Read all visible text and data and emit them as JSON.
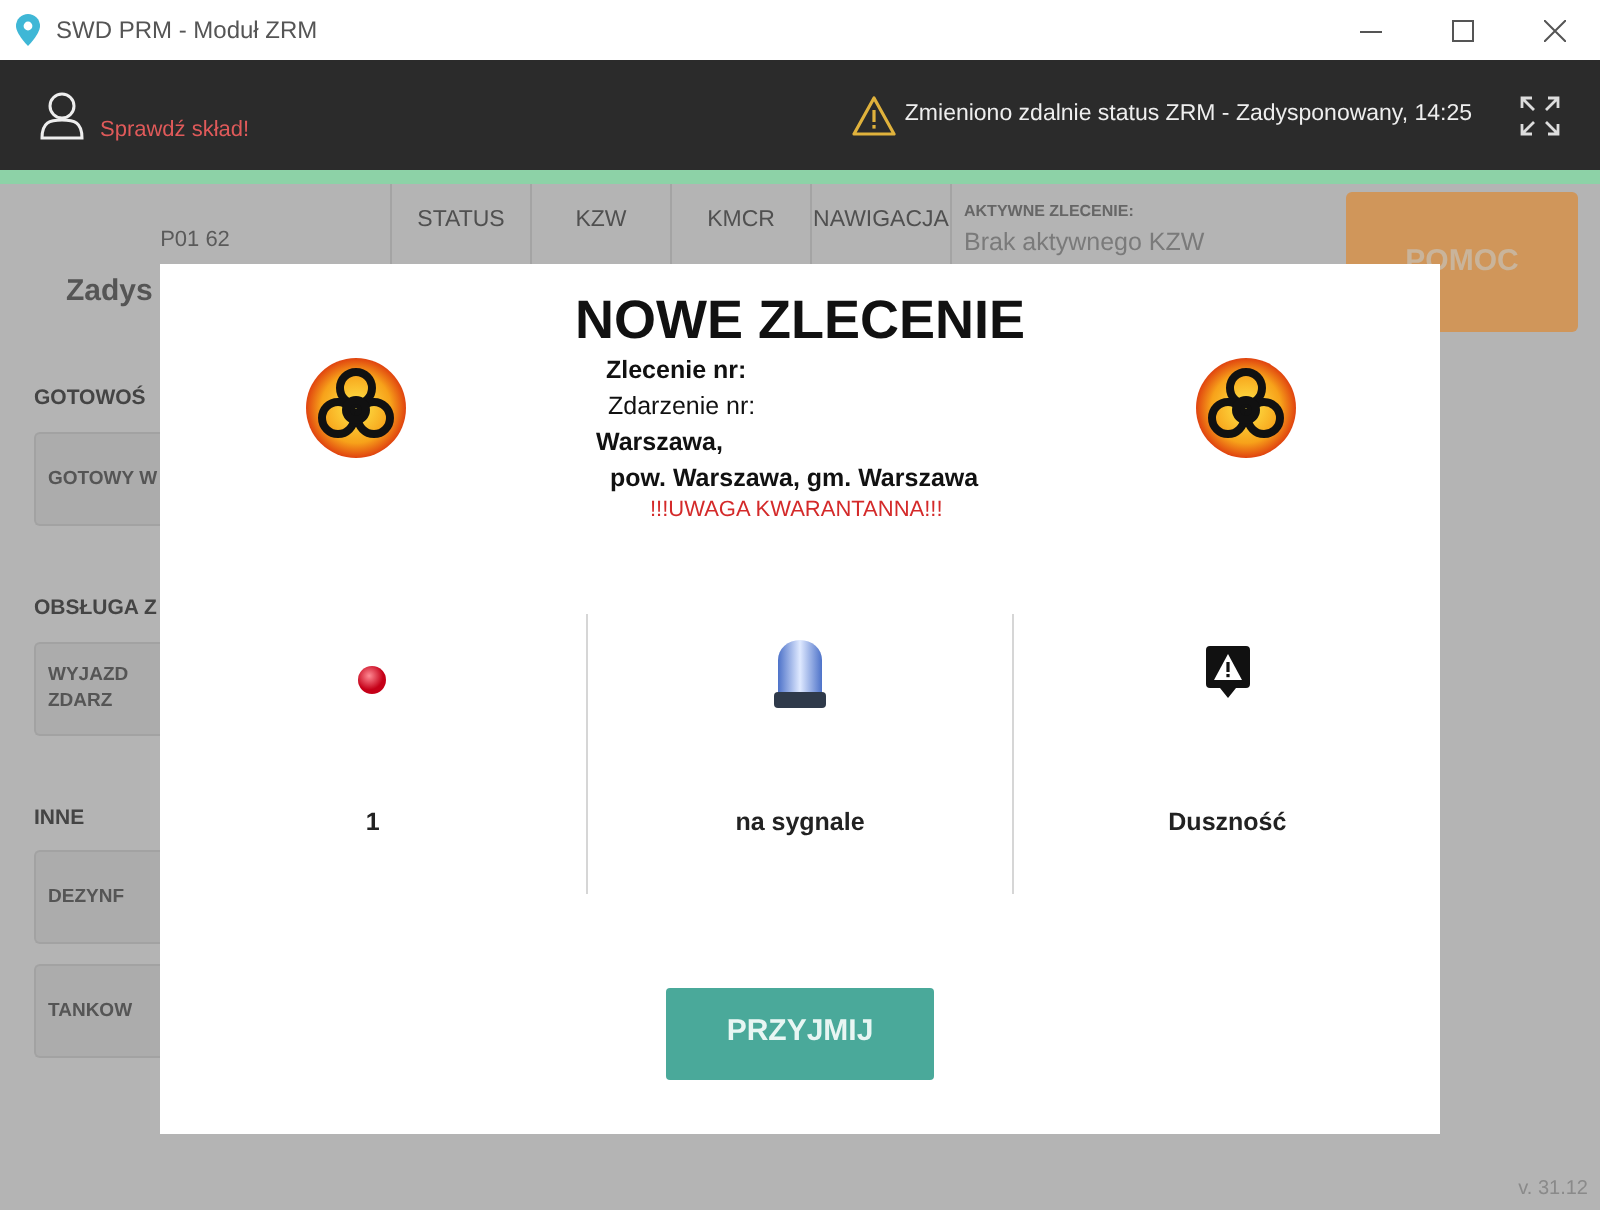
{
  "window": {
    "title": "SWD PRM - Moduł ZRM"
  },
  "header": {
    "crew_warning": "Sprawdź skład!",
    "notification": "Zmieniono zdalnie status ZRM - Zadysponowany, 14:25"
  },
  "unit": {
    "code": "P01 62",
    "status": "Zadys"
  },
  "tabs": [
    {
      "label": "STATUS"
    },
    {
      "label": "KZW"
    },
    {
      "label": "KMCR"
    },
    {
      "label": "NAWIGACJA"
    }
  ],
  "active_order": {
    "label": "AKTYWNE ZLECENIE:",
    "value": "Brak aktywnego KZW"
  },
  "help_button": "POMOC",
  "sections": [
    {
      "title": "GOTOWOŚ",
      "buttons": [
        {
          "lines": [
            "GOTOWY W"
          ]
        }
      ]
    },
    {
      "title": "OBSŁUGA Z",
      "buttons": [
        {
          "lines": [
            "WYJAZD",
            "ZDARZ"
          ]
        }
      ]
    },
    {
      "title": "INNE",
      "buttons": [
        {
          "lines": [
            "DEZYNF"
          ]
        },
        {
          "lines": [
            "TANKOW"
          ]
        }
      ]
    }
  ],
  "version": "v. 31.12",
  "modal": {
    "title": "NOWE ZLECENIE",
    "order_label": "Zlecenie nr:",
    "event_label": "Zdarzenie nr:",
    "address_lines": [
      "Warszawa,",
      "pow. Warszawa, gm. Warszawa"
    ],
    "alert": "!!!UWAGA KWARANTANNA!!!",
    "details": [
      {
        "kind": "priority",
        "text": "1"
      },
      {
        "kind": "siren",
        "text": "na sygnale"
      },
      {
        "kind": "symptom",
        "text": "Duszność"
      }
    ],
    "accept_button": "PRZYJMIJ"
  }
}
